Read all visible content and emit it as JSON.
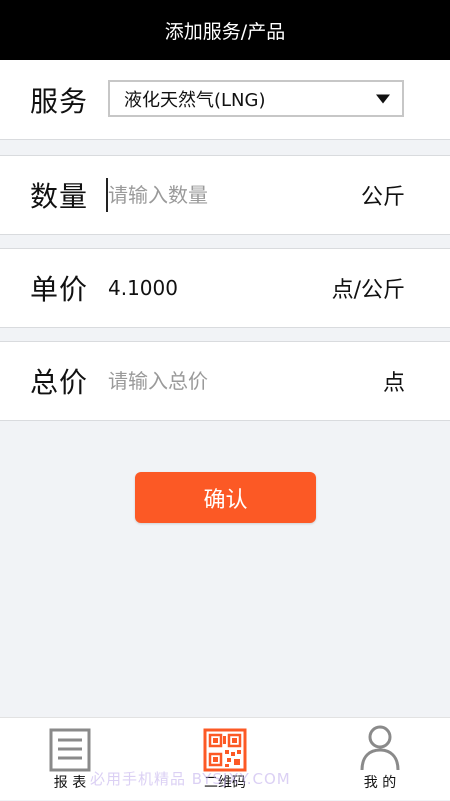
{
  "header": {
    "title": "添加服务/产品"
  },
  "service": {
    "label": "服务",
    "selected": "液化天然气(LNG)"
  },
  "quantity": {
    "label": "数量",
    "placeholder": "请输入数量",
    "unit": "公斤"
  },
  "unit_price": {
    "label": "单价",
    "value": "4.1000",
    "unit": "点/公斤"
  },
  "total_price": {
    "label": "总价",
    "placeholder": "请输入总价",
    "unit": "点"
  },
  "confirm": {
    "label": "确认"
  },
  "tabbar": {
    "items": [
      {
        "label": "报 表",
        "icon": "report-icon"
      },
      {
        "label": "二维码",
        "icon": "qrcode-icon"
      },
      {
        "label": "我 的",
        "icon": "person-icon"
      }
    ]
  },
  "watermark": {
    "text": "必用手机精品 BYSJXY.COM"
  },
  "colors": {
    "accent": "#fc5925",
    "header_bg": "#000000",
    "page_bg": "#f1f3f6"
  }
}
